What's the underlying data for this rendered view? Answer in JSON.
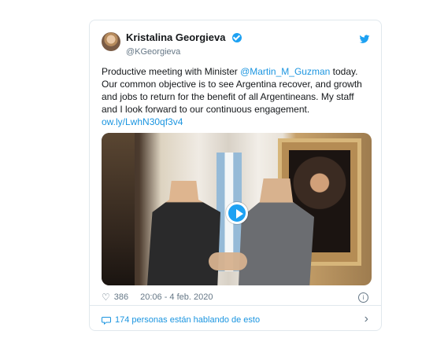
{
  "tweet": {
    "author_name": "Kristalina Georgieva",
    "author_handle": "@KGeorgieva",
    "text": {
      "part1": "Productive meeting with Minister ",
      "mention": "@Martin_M_Guzman",
      "part2": " today. Our common objective is to see Argentina recover, and growth and jobs to return for the benefit of all Argentineans. My staff and I look forward to our continuous engagement.",
      "link": "ow.ly/LwhN30qf3v4"
    },
    "likes": "386",
    "timestamp": "20:06 - 4 feb. 2020",
    "conversation_text": "174 personas están hablando de esto"
  },
  "icons": {
    "verified": "verified-badge-icon",
    "platform": "twitter-bird-icon",
    "play": "play-icon",
    "like": "heart-icon",
    "info": "info-icon",
    "conversation": "comment-icon",
    "chevron": "chevron-right-icon"
  },
  "colors": {
    "brand_blue": "#1da1f2",
    "link_blue": "#1b95e0",
    "secondary_text": "#657786",
    "border": "#e1e8ed"
  }
}
